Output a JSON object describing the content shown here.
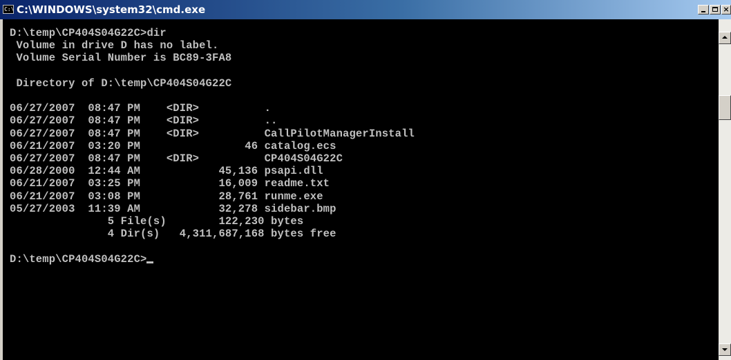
{
  "window": {
    "title": "C:\\WINDOWS\\system32\\cmd.exe",
    "icon_text": "C:\\",
    "minimize_label": "",
    "maximize_label": "",
    "close_label": "×"
  },
  "console": {
    "lines": [
      "D:\\temp\\CP404S04G22C>dir",
      " Volume in drive D has no label.",
      " Volume Serial Number is BC89-3FA8",
      "",
      " Directory of D:\\temp\\CP404S04G22C",
      "",
      "06/27/2007  08:47 PM    <DIR>          .",
      "06/27/2007  08:47 PM    <DIR>          ..",
      "06/27/2007  08:47 PM    <DIR>          CallPilotManagerInstall",
      "06/21/2007  03:20 PM                46 catalog.ecs",
      "06/27/2007  08:47 PM    <DIR>          CP404S04G22C",
      "06/28/2000  12:44 AM            45,136 psapi.dll",
      "06/21/2007  03:25 PM            16,009 readme.txt",
      "06/21/2007  03:08 PM            28,761 runme.exe",
      "05/27/2003  11:39 AM            32,278 sidebar.bmp",
      "               5 File(s)        122,230 bytes",
      "               4 Dir(s)   4,311,687,168 bytes free",
      ""
    ],
    "prompt": "D:\\temp\\CP404S04G22C>"
  },
  "colors": {
    "console_bg": "#000000",
    "console_fg": "#c0c0c0",
    "titlebar_start": "#0a246a",
    "titlebar_end": "#a6caf0"
  },
  "icons": {
    "window": "cmd-icon",
    "minimize": "minimize-icon",
    "maximize": "maximize-icon",
    "close": "close-icon",
    "scroll_up": "arrow-up-icon",
    "scroll_down": "arrow-down-icon"
  }
}
